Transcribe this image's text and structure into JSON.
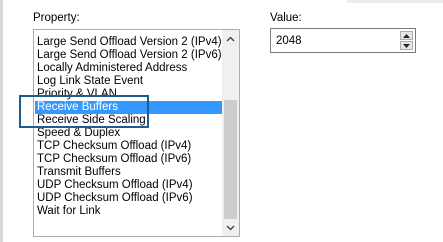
{
  "property": {
    "label": "Property:",
    "items": [
      "Large Send Offload Version 2 (IPv4)",
      "Large Send Offload Version 2 (IPv6)",
      "Locally Administered Address",
      "Log Link State Event",
      "Priority & VLAN",
      "Receive Buffers",
      "Receive Side Scaling",
      "Speed & Duplex",
      "TCP Checksum Offload (IPv4)",
      "TCP Checksum Offload (IPv6)",
      "Transmit Buffers",
      "UDP Checksum Offload (IPv4)",
      "UDP Checksum Offload (IPv6)",
      "Wait for Link"
    ],
    "selected": "Receive Buffers"
  },
  "value": {
    "label": "Value:",
    "current": "2048"
  }
}
